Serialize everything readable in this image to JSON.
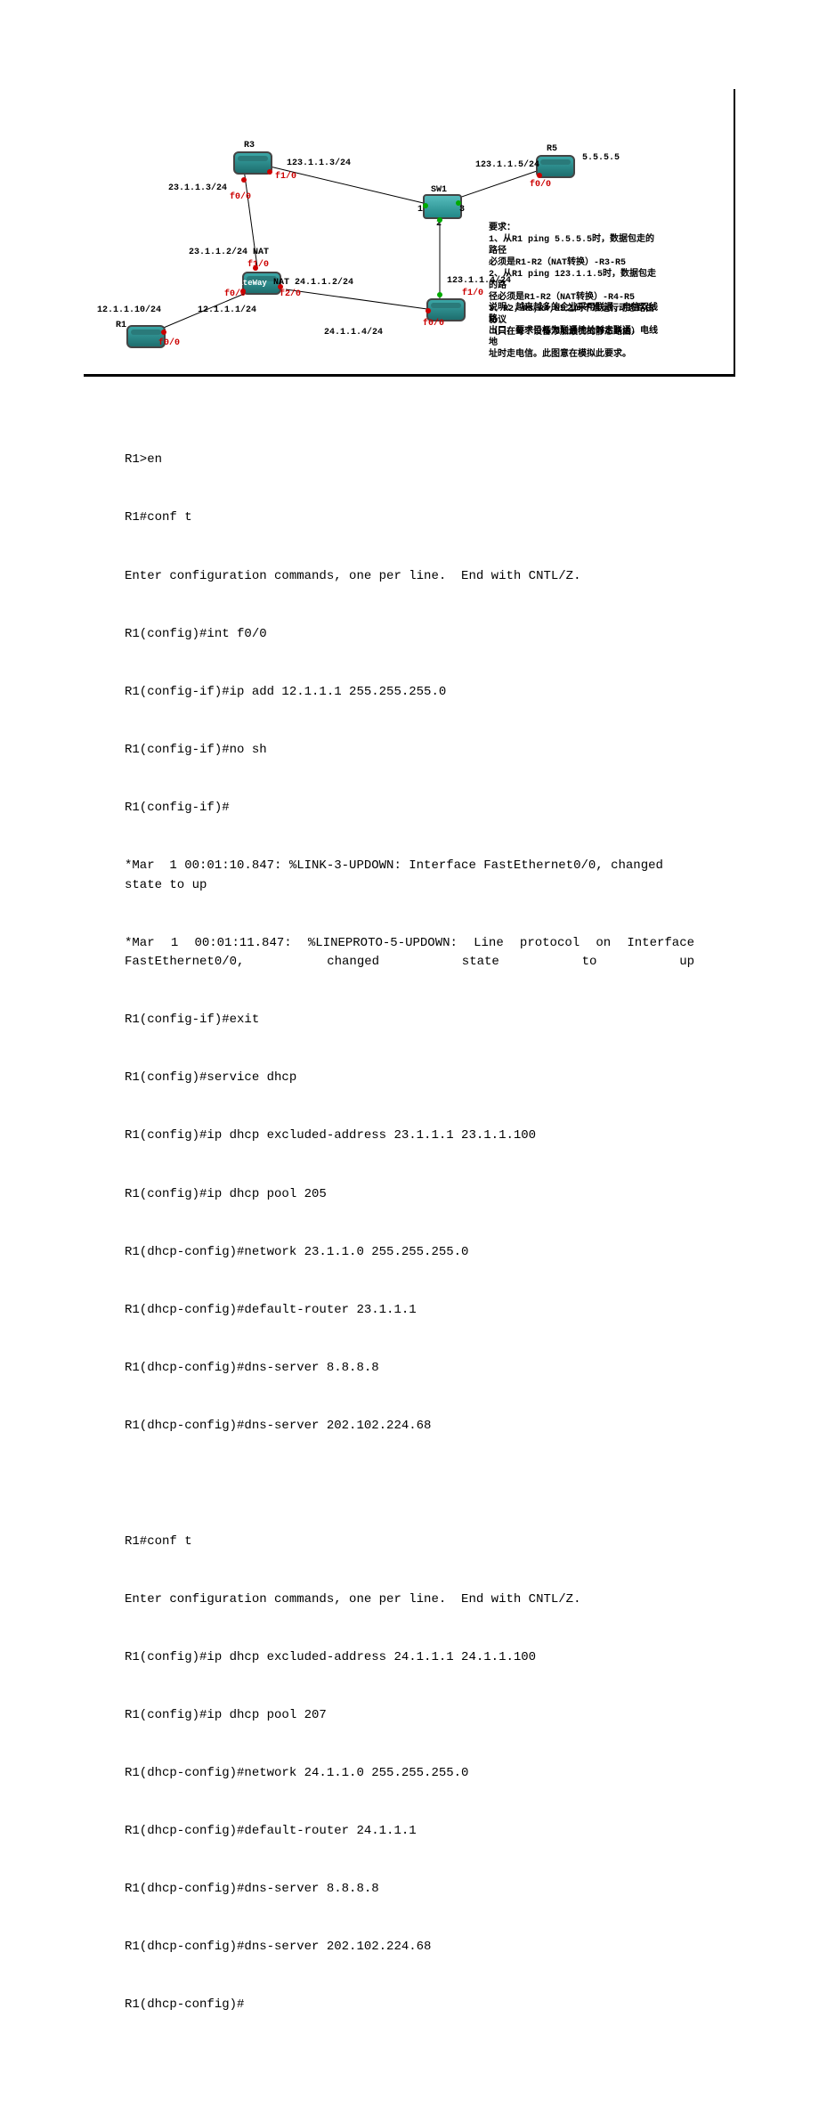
{
  "figure": {
    "nodes": {
      "r3": "R3",
      "r5": "R5",
      "sw1": "SW1",
      "gateway": "GateWay",
      "r1": "R1"
    },
    "nat_labels": {
      "nat1": "23.1.1.2/24 NAT",
      "nat2": "NAT 24.1.1.2/24"
    },
    "ip_labels": {
      "ip_123_1_1_3": "123.1.1.3/24",
      "ip_23_1_1_3": "23.1.1.3/24",
      "ip_123_1_1_5": "123.1.1.5/24",
      "ip_5555": "5.5.5.5",
      "ip_123_1_1_4": "123.1.1.4/24",
      "ip_12_1_1_10": "12.1.1.10/24",
      "ip_12_1_1_1": "12.1.1.1/24",
      "ip_24_1_1_4": "24.1.1.4/24"
    },
    "ports": {
      "f0_0": "f0/0",
      "f1_0": "f1/0",
      "f2_0": "f2/0",
      "n1": "1",
      "n2": "2",
      "n3": "3"
    },
    "notes": {
      "title": "要求：",
      "n1a": "1、从R1 ping 5.5.5.5时，数据包走的路径",
      "n1b": "必须是R1-R2（NAT转换）-R3-R5",
      "n2a": "2、从R1 ping 123.1.1.5时，数据包走的路",
      "n2b": "径必须是R1-R2（NAT转换）-R4-R5",
      "n3a": "3、R2，R3,R4,R5之间不准运行动态路由协议",
      "n3b": "（只在每个设备添加最优的静态路由）",
      "desc1": "说明：越来越多的企业采用联通、电信双线路",
      "desc2": "出口，要求目标为联通地址时走联通，电线地",
      "desc3": "址时走电信。此图意在模拟此要求。"
    }
  },
  "terminal": {
    "l1": "R1>en",
    "l2": "R1#conf t",
    "l3": "Enter configuration commands, one per line.  End with CNTL/Z.",
    "l4": "R1(config)#int f0/0",
    "l5": "R1(config-if)#ip add 12.1.1.1 255.255.255.0",
    "l6": "R1(config-if)#no sh",
    "l7": "R1(config-if)#",
    "l8": "*Mar  1 00:01:10.847: %LINK-3-UPDOWN: Interface FastEthernet0/0, changed state to up",
    "l9": "*Mar  1  00:01:11.847:  %LINEPROTO-5-UPDOWN:  Line  protocol  on  Interface FastEthernet0/0, changed state to up",
    "l10": "R1(config-if)#exit",
    "l11": "R1(config)#service dhcp",
    "l12": "R1(config)#ip dhcp excluded-address 23.1.1.1 23.1.1.100",
    "l13": "R1(config)#ip dhcp pool 205",
    "l14": "R1(dhcp-config)#network 23.1.1.0 255.255.255.0",
    "l15": "R1(dhcp-config)#default-router 23.1.1.1",
    "l16": "R1(dhcp-config)#dns-server 8.8.8.8",
    "l17": "R1(dhcp-config)#dns-server 202.102.224.68",
    "l18": "",
    "l19": "R1#conf t",
    "l20": "Enter configuration commands, one per line.  End with CNTL/Z.",
    "l21": "R1(config)#ip dhcp excluded-address 24.1.1.1 24.1.1.100",
    "l22": "R1(config)#ip dhcp pool 207",
    "l23": "R1(dhcp-config)#network 24.1.1.0 255.255.255.0",
    "l24": "R1(dhcp-config)#default-router 24.1.1.1",
    "l25": "R1(dhcp-config)#dns-server 8.8.8.8",
    "l26": "R1(dhcp-config)#dns-server 202.102.224.68",
    "l27": "R1(dhcp-config)#"
  }
}
